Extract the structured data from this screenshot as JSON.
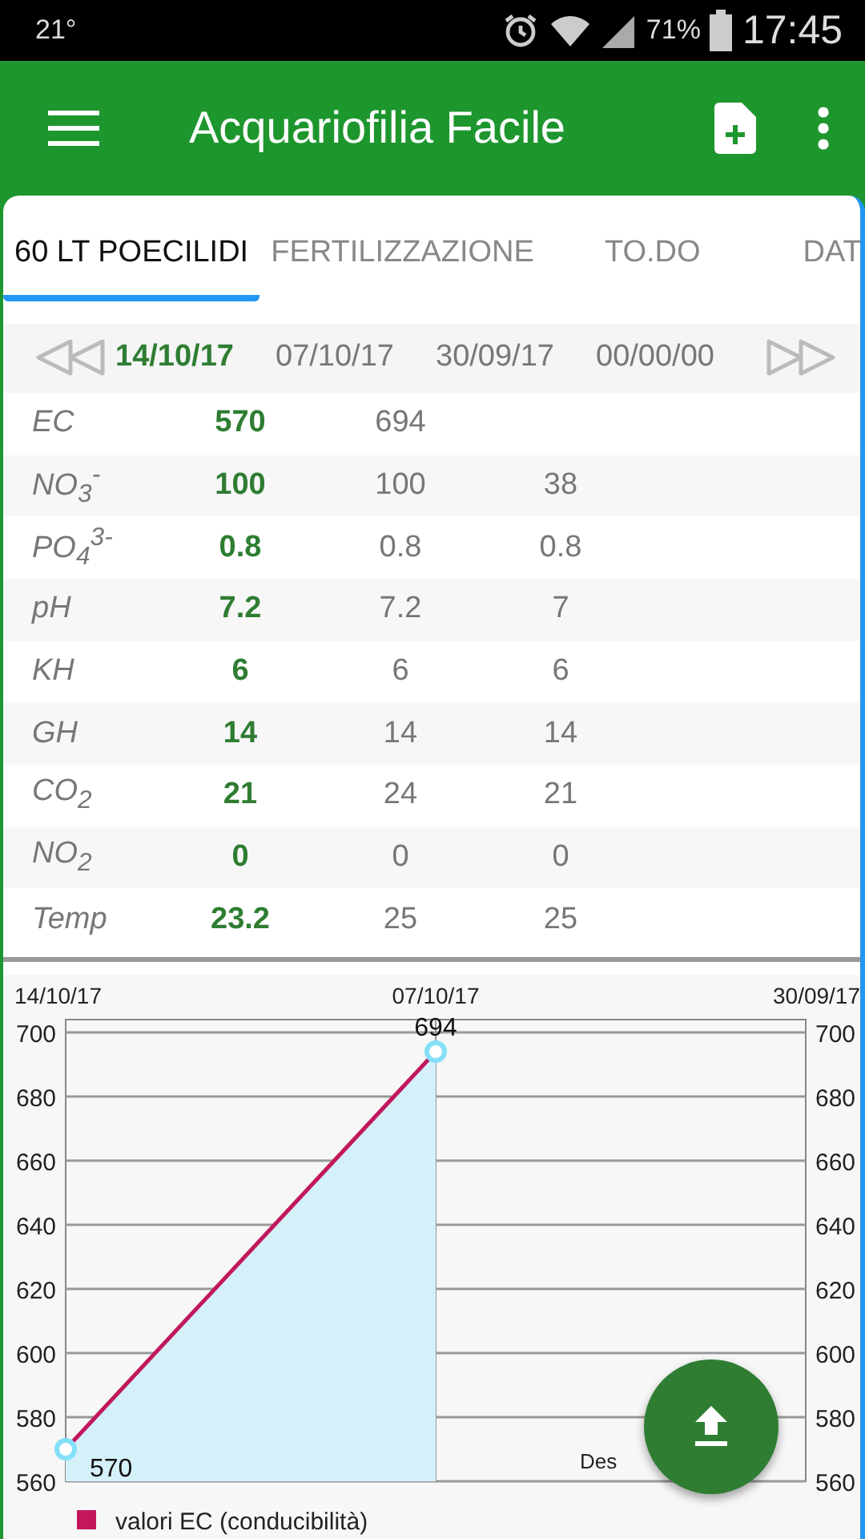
{
  "status_bar": {
    "temperature": "21°",
    "battery": "71%",
    "time": "17:45"
  },
  "app_bar": {
    "title": "Acquariofilia Facile"
  },
  "tabs": [
    {
      "label": "60 LT POECILIDI",
      "selected": true
    },
    {
      "label": "FERTILIZZAZIONE",
      "selected": false
    },
    {
      "label": "TO.DO",
      "selected": false
    },
    {
      "label": "DAT",
      "selected": false
    }
  ],
  "dates": [
    {
      "label": "14/10/17",
      "selected": true
    },
    {
      "label": "07/10/17",
      "selected": false
    },
    {
      "label": "30/09/17",
      "selected": false
    },
    {
      "label": "00/00/00",
      "selected": false
    }
  ],
  "parameters": [
    {
      "name": "EC",
      "values": [
        "570",
        "694"
      ]
    },
    {
      "name": "NO$_{3}$$^{-}$",
      "values": [
        "100",
        "100",
        "38"
      ]
    },
    {
      "name": "PO$_{4}$$^{3-}$",
      "values": [
        "0.8",
        "0.8",
        "0.8"
      ]
    },
    {
      "name": "pH",
      "values": [
        "7.2",
        "7.2",
        "7"
      ]
    },
    {
      "name": "KH",
      "values": [
        "6",
        "6",
        "6"
      ]
    },
    {
      "name": "GH",
      "values": [
        "14",
        "14",
        "14"
      ]
    },
    {
      "name": "CO$_{2}$",
      "values": [
        "21",
        "24",
        "21"
      ]
    },
    {
      "name": "NO$_{2}$",
      "values": [
        "0",
        "0",
        "0"
      ]
    },
    {
      "name": "Temp",
      "values": [
        "23.2",
        "25",
        "25"
      ]
    }
  ],
  "chart": {
    "description": "Des",
    "chart_data": {
      "type": "area",
      "categories": [
        "14/10/17",
        "07/10/17",
        "30/09/17"
      ],
      "series": [
        {
          "name": "valori EC (conducibilità)",
          "color": "#c2185b",
          "values": [
            570,
            694,
            null
          ]
        }
      ],
      "ylim": [
        560,
        700
      ],
      "yticks": [
        560,
        580,
        600,
        620,
        640,
        660,
        680,
        700
      ],
      "y2lim": [
        560,
        700
      ],
      "y2ticks": [
        560,
        580,
        600,
        620,
        640,
        660,
        680,
        700
      ],
      "grid": true,
      "ref_lines": [
        {
          "axis": "x",
          "value": "07/10/17"
        }
      ],
      "value_labels": [
        "570",
        "694"
      ]
    }
  }
}
